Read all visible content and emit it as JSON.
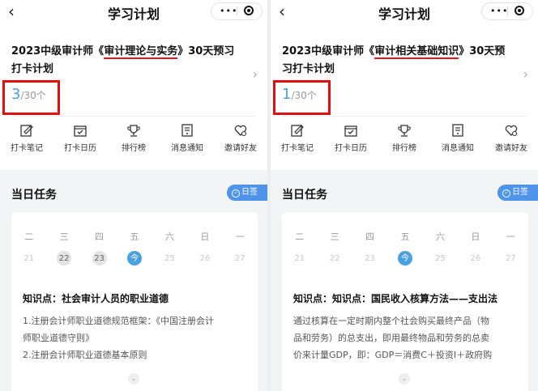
{
  "panels": [
    {
      "nav": {
        "title": "学习计划",
        "back": "‹",
        "more": "•••"
      },
      "plan": {
        "title_prefix": "2023中级审计师《",
        "title_highlight": "审计理论与实务",
        "title_suffix": "》30天预习打卡计划",
        "done": "3",
        "total": "/30个"
      },
      "actions": [
        "打卡笔记",
        "打卡日历",
        "排行榜",
        "消息通知",
        "邀请好友"
      ],
      "task": {
        "title": "当日任务",
        "sign": "日签",
        "weekdays": [
          "二",
          "三",
          "四",
          "五",
          "六",
          "日",
          "一"
        ],
        "dates": [
          "21",
          "22",
          "23",
          "今",
          "25",
          "26",
          "27"
        ],
        "kp_title": "知识点：社会审计人员的职业道德",
        "kp_lines": [
          "1.注册会计师职业道德规范框架：《中国注册会计",
          "师职业道德守则》",
          "2.注册会计师职业道德基本原则"
        ]
      }
    },
    {
      "nav": {
        "title": "学习计划",
        "back": "‹",
        "more": "•••"
      },
      "plan": {
        "title_prefix": "2023中级审计师《",
        "title_highlight": "审计相关基础知识",
        "title_suffix": "》30天预习打卡计划",
        "done": "1",
        "total": "/30个"
      },
      "actions": [
        "打卡笔记",
        "打卡日历",
        "排行榜",
        "消息通知",
        "邀请好友"
      ],
      "task": {
        "title": "当日任务",
        "sign": "日签",
        "weekdays": [
          "二",
          "三",
          "四",
          "五",
          "六",
          "日",
          "一"
        ],
        "dates": [
          "21",
          "22",
          "23",
          "今",
          "25",
          "26",
          "27"
        ],
        "kp_title": "知识点：知识点：国民收入核算方法——支出法",
        "kp_lines": [
          "通过核算在一定时期内整个社会购买最终产品（物",
          "品和劳务）的总支出，即用最终物品和劳务的总卖",
          "价来计量GDP，即：GDP＝消费C＋投资I＋政府购"
        ]
      }
    }
  ],
  "colors": {
    "accent": "#4ba0e0",
    "highlight_box": "#e01010",
    "underline": "#d81e1e",
    "sign_button": "#4d94ea"
  },
  "icons": [
    "note-icon",
    "calendar-check-icon",
    "trophy-icon",
    "message-icon",
    "heart-gear-icon"
  ]
}
